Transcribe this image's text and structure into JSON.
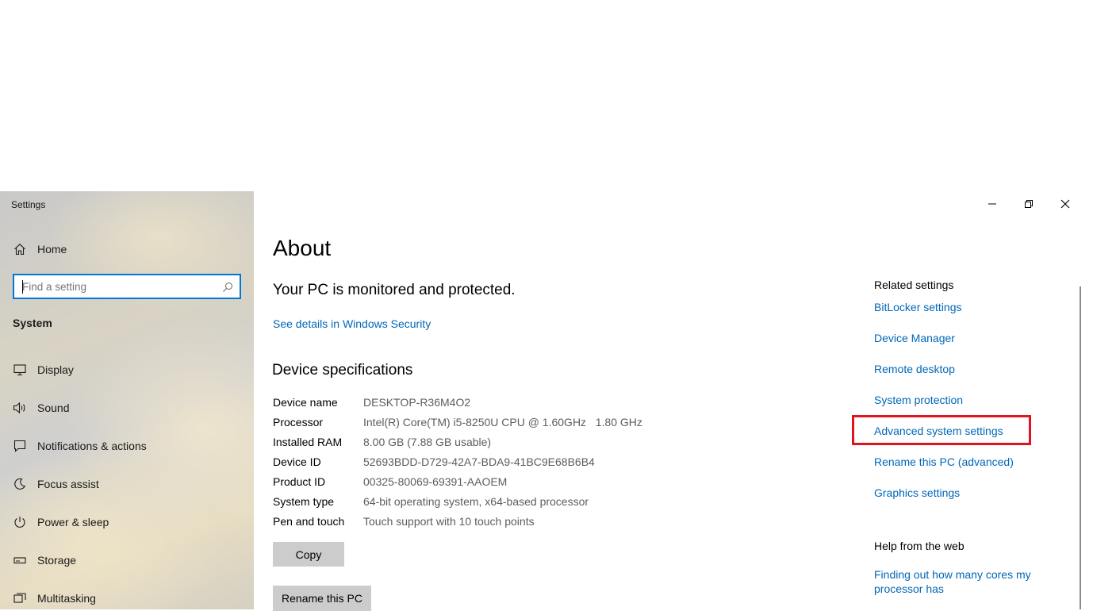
{
  "app_title": "Settings",
  "sidebar": {
    "home_label": "Home",
    "search_placeholder": "Find a setting",
    "section_label": "System",
    "items": [
      {
        "label": "Display",
        "icon": "display-icon"
      },
      {
        "label": "Sound",
        "icon": "sound-icon"
      },
      {
        "label": "Notifications & actions",
        "icon": "notifications-icon"
      },
      {
        "label": "Focus assist",
        "icon": "focus-assist-icon"
      },
      {
        "label": "Power & sleep",
        "icon": "power-icon"
      },
      {
        "label": "Storage",
        "icon": "storage-icon"
      },
      {
        "label": "Multitasking",
        "icon": "multitasking-icon"
      }
    ]
  },
  "main": {
    "title": "About",
    "protection_heading": "Your PC is monitored and protected.",
    "security_link": "See details in Windows Security",
    "spec_heading": "Device specifications",
    "specs": [
      {
        "key": "Device name",
        "value": "DESKTOP-R36M4O2"
      },
      {
        "key": "Processor",
        "value": "Intel(R) Core(TM) i5-8250U CPU @ 1.60GHz   1.80 GHz"
      },
      {
        "key": "Installed RAM",
        "value": "8.00 GB (7.88 GB usable)"
      },
      {
        "key": "Device ID",
        "value": "52693BDD-D729-42A7-BDA9-41BC9E68B6B4"
      },
      {
        "key": "Product ID",
        "value": "00325-80069-69391-AAOEM"
      },
      {
        "key": "System type",
        "value": "64-bit operating system, x64-based processor"
      },
      {
        "key": "Pen and touch",
        "value": "Touch support with 10 touch points"
      }
    ],
    "copy_button": "Copy",
    "rename_button": "Rename this PC"
  },
  "related": {
    "title": "Related settings",
    "links": [
      "BitLocker settings",
      "Device Manager",
      "Remote desktop",
      "System protection",
      "Advanced system settings",
      "Rename this PC (advanced)",
      "Graphics settings"
    ],
    "highlighted_index": 4
  },
  "help": {
    "title": "Help from the web",
    "link": "Finding out how many cores my processor has"
  },
  "colors": {
    "accent": "#0078d7",
    "link": "#0067b8",
    "highlight": "#e0141e"
  }
}
